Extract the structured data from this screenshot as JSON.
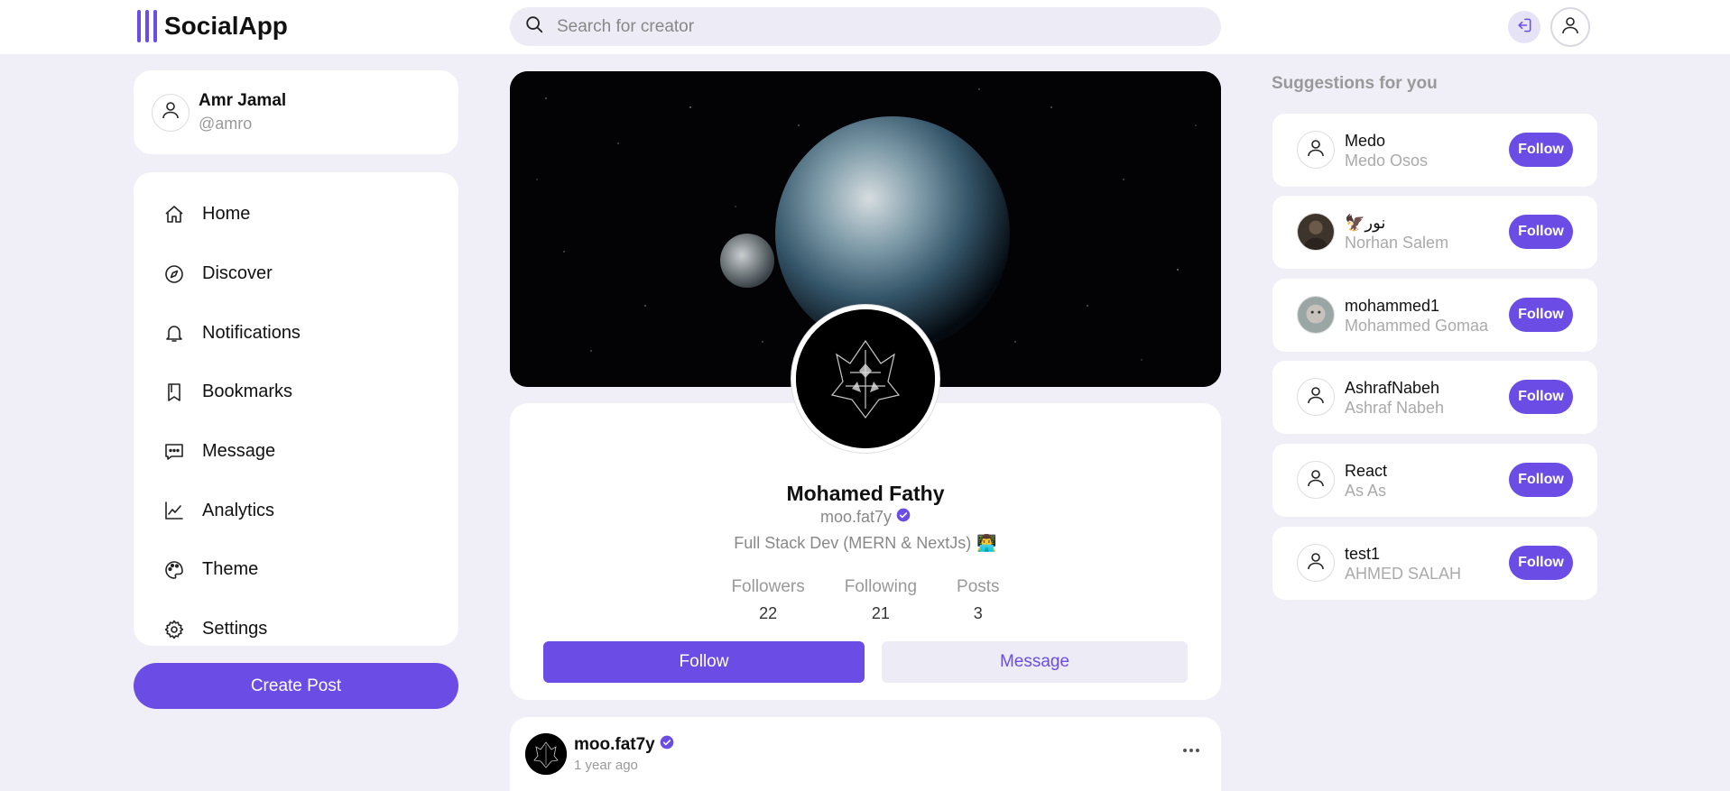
{
  "app": {
    "name": "SocialApp"
  },
  "search": {
    "placeholder": "Search for creator"
  },
  "current_user": {
    "name": "Amr Jamal",
    "handle": "@amro"
  },
  "nav": {
    "items": [
      {
        "label": "Home",
        "icon": "home-icon"
      },
      {
        "label": "Discover",
        "icon": "compass-icon"
      },
      {
        "label": "Notifications",
        "icon": "bell-icon"
      },
      {
        "label": "Bookmarks",
        "icon": "bookmark-icon"
      },
      {
        "label": "Message",
        "icon": "message-icon"
      },
      {
        "label": "Analytics",
        "icon": "chart-icon"
      },
      {
        "label": "Theme",
        "icon": "palette-icon"
      },
      {
        "label": "Settings",
        "icon": "gear-icon"
      }
    ],
    "create_post_label": "Create Post"
  },
  "profile": {
    "name": "Mohamed Fathy",
    "handle": "moo.fat7y",
    "bio": "Full Stack Dev (MERN & NextJs)",
    "bio_emoji": "👨‍💻",
    "stats": [
      {
        "label": "Followers",
        "value": "22"
      },
      {
        "label": "Following",
        "value": "21"
      },
      {
        "label": "Posts",
        "value": "3"
      }
    ],
    "follow_label": "Follow",
    "message_label": "Message"
  },
  "post": {
    "user": "moo.fat7y",
    "time": "1 year ago",
    "more_icon": "more-icon"
  },
  "suggestions": {
    "title": "Suggestions for you",
    "items": [
      {
        "username": "Medo",
        "fullname": "Medo Osos",
        "follow_label": "Follow"
      },
      {
        "username": "🦅نور",
        "fullname": "Norhan Salem",
        "follow_label": "Follow"
      },
      {
        "username": "mohammed1",
        "fullname": "Mohammed Gomaa",
        "follow_label": "Follow"
      },
      {
        "username": "AshrafNabeh",
        "fullname": "Ashraf Nabeh",
        "follow_label": "Follow"
      },
      {
        "username": "React",
        "fullname": "As As",
        "follow_label": "Follow"
      },
      {
        "username": "test1",
        "fullname": "AHMED SALAH",
        "follow_label": "Follow"
      }
    ]
  },
  "colors": {
    "accent": "#6b4de6",
    "page_bg": "#f0eff7",
    "muted": "#999999"
  }
}
